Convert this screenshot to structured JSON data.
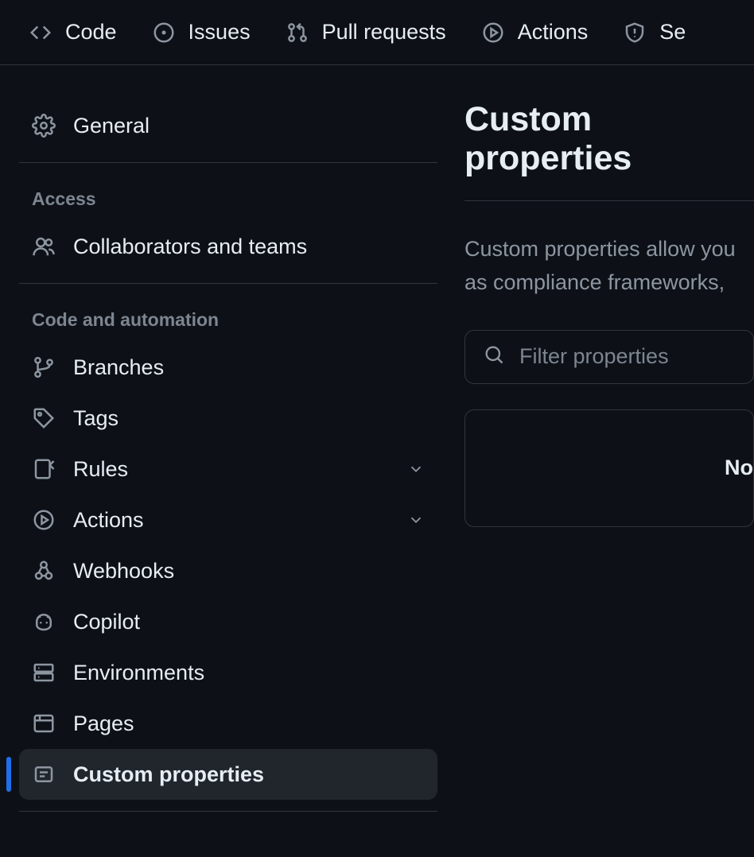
{
  "top_nav": {
    "code": "Code",
    "issues": "Issues",
    "pulls": "Pull requests",
    "actions": "Actions",
    "security": "Se"
  },
  "sidebar": {
    "general": "General",
    "access_heading": "Access",
    "collaborators": "Collaborators and teams",
    "code_heading": "Code and automation",
    "branches": "Branches",
    "tags": "Tags",
    "rules": "Rules",
    "actions": "Actions",
    "webhooks": "Webhooks",
    "copilot": "Copilot",
    "environments": "Environments",
    "pages": "Pages",
    "custom_properties": "Custom properties"
  },
  "main": {
    "title": "Custom properties",
    "description_line1": "Custom properties allow you",
    "description_line2": "as compliance frameworks, ",
    "search_placeholder": "Filter properties",
    "empty_text": "No"
  }
}
